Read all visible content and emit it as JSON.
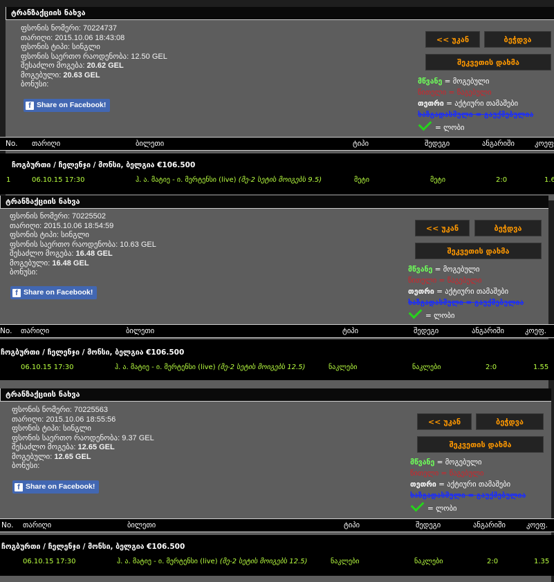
{
  "common": {
    "header": "ტრანზაქციის ნახვა",
    "labels": {
      "slip_number": "ფსონის ნომერი:",
      "date": "თარიღი:",
      "slip_type": "ფსონის ტიპი:",
      "total_odds": "ფსონის საერთო რაოდენობა:",
      "possible_win": "შესაძლო მოგება:",
      "winnings": "მოგებული:",
      "bonus": "ბონუსი:"
    },
    "facebook_label": "Share on Facebook!",
    "facebook_glyph": "f",
    "buttons": {
      "back": "<< უკან",
      "print": "ბეჭდვა",
      "sort": "შეკვეთის დახმა"
    },
    "legend": {
      "win_key": "მწვანე",
      "win_value": "= მოგებული",
      "lose": "წითელი = წაგებული",
      "active_key": "თეთრი",
      "active_value": "= აქტიური თამაშები",
      "void": "ხაზგადასმული = გაუქმებულია",
      "return_value": "= ლობი"
    },
    "table_headers": [
      "No.",
      "თარიღი",
      "ბილეთი",
      "ტიპი",
      "შედეგი",
      "ანგარიში",
      "კოეფ."
    ],
    "event_title": "ჩოგბურთი / ჩელენჯი / მონსი, ბელგია €106.500",
    "colors": {
      "panel_bg": "#5d5d5d",
      "win": "#6eff5a",
      "lose": "#d2232a",
      "void": "#1a2cff",
      "button_text": "#ff9800"
    }
  },
  "slips": [
    {
      "slip_number": "70224737",
      "date": "2015.10.06 18:43:08",
      "slip_type": "სინგლი",
      "total_odds": "12.50 GEL",
      "possible_win": "20.62 GEL",
      "winnings": "20.63 GEL",
      "bonus": "",
      "row": {
        "no": "1",
        "date": "06.10.15 17:30",
        "ticket": "ჰ. ა. მატიე - ი. მერტენსი (live)",
        "ticket_note": "(მე-2 სეტის მოიგებს 9.5)",
        "type": "მეტი",
        "result": "მეტი",
        "score": "2:0",
        "odds": "1.6"
      }
    },
    {
      "slip_number": "70225502",
      "date": "2015.10.06 18:54:59",
      "slip_type": "სინგლი",
      "total_odds": "10.63 GEL",
      "possible_win": "16.48 GEL",
      "winnings": "16.48 GEL",
      "bonus": "",
      "row": {
        "no": "",
        "date": "06.10.15 17:30",
        "ticket": "ჰ. ა. მატიე - ი. მერტენსი (live)",
        "ticket_note": "(მე-2 სეტის მოიგებს 12.5)",
        "type": "ნაკლები",
        "result": "ნაკლები",
        "score": "2:0",
        "odds": "1.55"
      }
    },
    {
      "slip_number": "70225563",
      "date": "2015.10.06 18:55:56",
      "slip_type": "სინგლი",
      "total_odds": "9.37 GEL",
      "possible_win": "12.65 GEL",
      "winnings": "12.65 GEL",
      "bonus": "",
      "row": {
        "no": "",
        "date": "06.10.15 17:30",
        "ticket": "ჰ. ა. მატიე - ი. მერტენსი (live)",
        "ticket_note": "(მე-2 სეტის მოიგებს 12.5)",
        "type": "ნაკლები",
        "result": "ნაკლები",
        "score": "2:0",
        "odds": "1.35"
      }
    }
  ]
}
